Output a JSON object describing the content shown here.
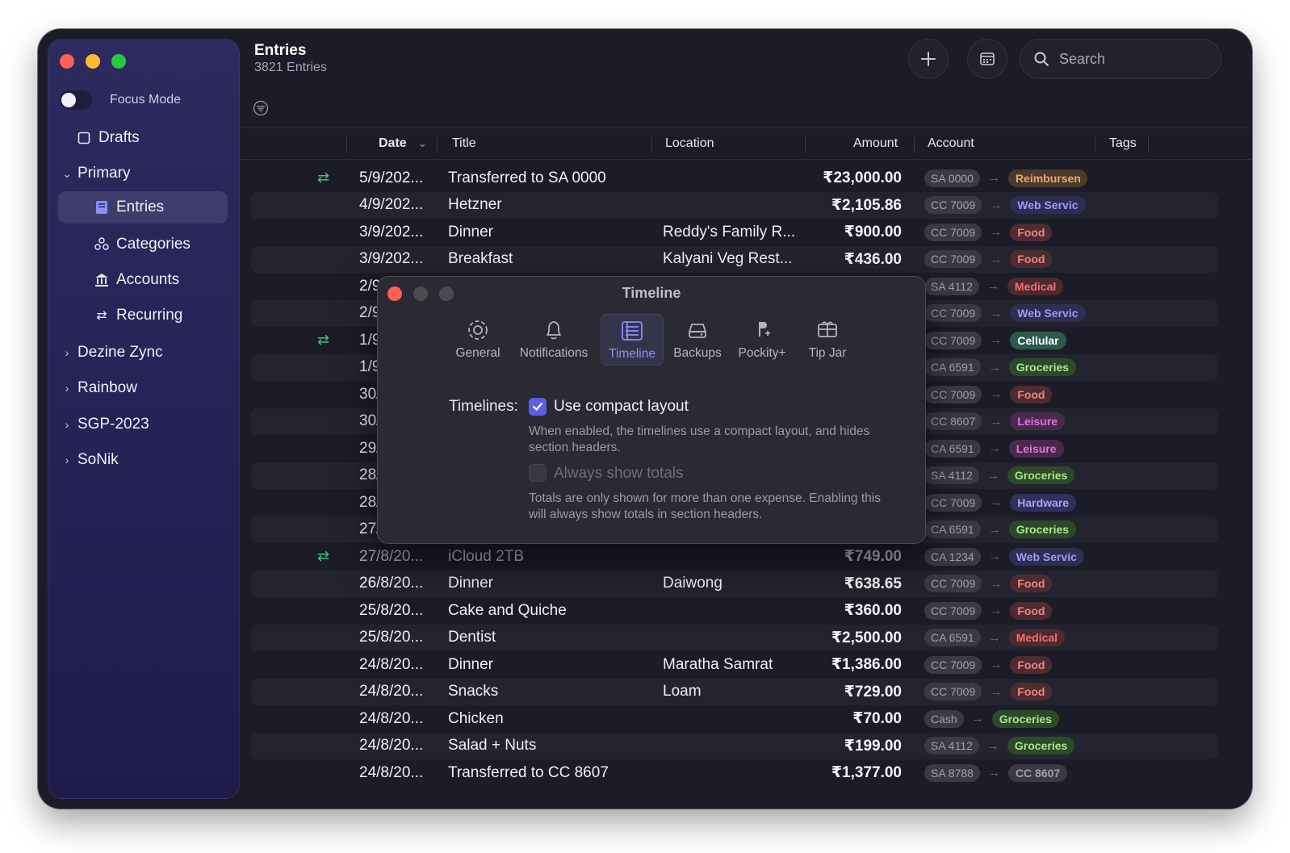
{
  "sidebar": {
    "focus_mode_label": "Focus Mode",
    "drafts_label": "Drafts",
    "primary_label": "Primary",
    "entries_label": "Entries",
    "categories_label": "Categories",
    "accounts_label": "Accounts",
    "recurring_label": "Recurring",
    "groups": [
      "Dezine Zync",
      "Rainbow",
      "SGP-2023",
      "SoNik"
    ]
  },
  "header": {
    "title": "Entries",
    "subtitle": "3821 Entries",
    "search_placeholder": "Search"
  },
  "columns": {
    "date": "Date",
    "title": "Title",
    "location": "Location",
    "amount": "Amount",
    "account": "Account",
    "tags": "Tags"
  },
  "rows": [
    {
      "recurring": true,
      "date": "5/9/202...",
      "title": "Transferred to SA 0000",
      "location": "",
      "amount": "₹23,000.00",
      "account": "SA 0000",
      "tag": "Reimbursen",
      "tag_color": "#e8a870",
      "tag_bg": "#4a3a2c"
    },
    {
      "recurring": false,
      "date": "4/9/202...",
      "title": "Hetzner",
      "location": "",
      "amount": "₹2,105.86",
      "account": "CC 7009",
      "tag": "Web Servic",
      "tag_color": "#9c9cf4",
      "tag_bg": "#2e2e52"
    },
    {
      "recurring": false,
      "date": "3/9/202...",
      "title": "Dinner",
      "location": "Reddy's Family R...",
      "amount": "₹900.00",
      "account": "CC 7009",
      "tag": "Food",
      "tag_color": "#f08484",
      "tag_bg": "#4c2c30"
    },
    {
      "recurring": false,
      "date": "3/9/202...",
      "title": "Breakfast",
      "location": "Kalyani Veg Rest...",
      "amount": "₹436.00",
      "account": "CC 7009",
      "tag": "Food",
      "tag_color": "#f08484",
      "tag_bg": "#4c2c30"
    },
    {
      "recurring": false,
      "date": "2/9/202...",
      "title": "",
      "location": "",
      "amount": "",
      "account": "SA 4112",
      "tag": "Medical",
      "tag_color": "#f07070",
      "tag_bg": "#4c2a2e"
    },
    {
      "recurring": false,
      "date": "2/9/202...",
      "title": "",
      "location": "",
      "amount": "",
      "account": "CC 7009",
      "tag": "Web Servic",
      "tag_color": "#9c9cf4",
      "tag_bg": "#2e2e52"
    },
    {
      "recurring": true,
      "date": "1/9/202...",
      "title": "",
      "location": "",
      "amount": "",
      "account": "CC 7009",
      "tag": "Cellular",
      "tag_color": "#ffffff",
      "tag_bg": "#2c5a4c"
    },
    {
      "recurring": false,
      "date": "1/9/202...",
      "title": "",
      "location": "",
      "amount": "",
      "account": "CA 6591",
      "tag": "Groceries",
      "tag_color": "#a8e68c",
      "tag_bg": "#2c4a2a"
    },
    {
      "recurring": false,
      "date": "30/8/20...",
      "title": "",
      "location": "",
      "amount": "",
      "account": "CC 7009",
      "tag": "Food",
      "tag_color": "#f08484",
      "tag_bg": "#4c2c30"
    },
    {
      "recurring": false,
      "date": "30/8/20...",
      "title": "",
      "location": "",
      "amount": "",
      "account": "CC 8607",
      "tag": "Leisure",
      "tag_color": "#e070e0",
      "tag_bg": "#4a2a4c"
    },
    {
      "recurring": false,
      "date": "29/8/20...",
      "title": "",
      "location": "",
      "amount": "",
      "account": "CA 6591",
      "tag": "Leisure",
      "tag_color": "#e070e0",
      "tag_bg": "#4a2a4c"
    },
    {
      "recurring": false,
      "date": "28/8/20...",
      "title": "",
      "location": "",
      "amount": "",
      "account": "SA 4112",
      "tag": "Groceries",
      "tag_color": "#a8e68c",
      "tag_bg": "#2c4a2a"
    },
    {
      "recurring": false,
      "date": "28/8/20...",
      "title": "",
      "location": "",
      "amount": "",
      "account": "CC 7009",
      "tag": "Hardware",
      "tag_color": "#a4a4f8",
      "tag_bg": "#30305a"
    },
    {
      "recurring": false,
      "date": "27/8/20...",
      "title": "",
      "location": "",
      "amount": "",
      "account": "CA 6591",
      "tag": "Groceries",
      "tag_color": "#a8e68c",
      "tag_bg": "#2c4a2a"
    },
    {
      "recurring": true,
      "date": "27/8/20...",
      "title": "iCloud 2TB",
      "location": "",
      "amount": "₹749.00",
      "account": "CA 1234",
      "tag": "Web Servic",
      "tag_color": "#9c9cf4",
      "tag_bg": "#2e2e52",
      "dim": true
    },
    {
      "recurring": false,
      "date": "26/8/20...",
      "title": "Dinner",
      "location": "Daiwong",
      "amount": "₹638.65",
      "account": "CC 7009",
      "tag": "Food",
      "tag_color": "#f08484",
      "tag_bg": "#4c2c30"
    },
    {
      "recurring": false,
      "date": "25/8/20...",
      "title": "Cake and Quiche",
      "location": "",
      "amount": "₹360.00",
      "account": "CC 7009",
      "tag": "Food",
      "tag_color": "#f08484",
      "tag_bg": "#4c2c30"
    },
    {
      "recurring": false,
      "date": "25/8/20...",
      "title": "Dentist",
      "location": "",
      "amount": "₹2,500.00",
      "account": "CA 6591",
      "tag": "Medical",
      "tag_color": "#f07070",
      "tag_bg": "#4c2a2e"
    },
    {
      "recurring": false,
      "date": "24/8/20...",
      "title": "Dinner",
      "location": "Maratha Samrat",
      "amount": "₹1,386.00",
      "account": "CC 7009",
      "tag": "Food",
      "tag_color": "#f08484",
      "tag_bg": "#4c2c30"
    },
    {
      "recurring": false,
      "date": "24/8/20...",
      "title": "Snacks",
      "location": "Loam",
      "amount": "₹729.00",
      "account": "CC 7009",
      "tag": "Food",
      "tag_color": "#f08484",
      "tag_bg": "#4c2c30"
    },
    {
      "recurring": false,
      "date": "24/8/20...",
      "title": "Chicken",
      "location": "",
      "amount": "₹70.00",
      "account": "Cash",
      "tag": "Groceries",
      "tag_color": "#a8e68c",
      "tag_bg": "#2c4a2a"
    },
    {
      "recurring": false,
      "date": "24/8/20...",
      "title": "Salad + Nuts",
      "location": "",
      "amount": "₹199.00",
      "account": "SA 4112",
      "tag": "Groceries",
      "tag_color": "#a8e68c",
      "tag_bg": "#2c4a2a"
    },
    {
      "recurring": false,
      "date": "24/8/20...",
      "title": "Transferred to CC 8607",
      "location": "",
      "amount": "₹1,377.00",
      "account": "SA 8788",
      "tag": "CC 8607",
      "tag_color": "#a0a0ac",
      "tag_bg": "#3a3a44"
    }
  ],
  "modal": {
    "title": "Timeline",
    "tabs": [
      {
        "label": "General",
        "icon": "gear-icon"
      },
      {
        "label": "Notifications",
        "icon": "bell-icon"
      },
      {
        "label": "Timeline",
        "icon": "timeline-icon"
      },
      {
        "label": "Backups",
        "icon": "drive-icon"
      },
      {
        "label": "Pockity+",
        "icon": "pockity-plus-icon"
      },
      {
        "label": "Tip Jar",
        "icon": "gift-icon"
      }
    ],
    "active_tab": "Timeline",
    "section_label": "Timelines:",
    "compact_label": "Use compact layout",
    "compact_checked": true,
    "compact_help": "When enabled, the timelines use a compact layout, and hides section headers.",
    "totals_label": "Always show totals",
    "totals_checked": false,
    "totals_help": "Totals are only shown for more than one expense. Enabling this will always show totals in section headers."
  },
  "colors": {
    "accent": "#5e5ce6",
    "recurring": "#3fc37a"
  }
}
